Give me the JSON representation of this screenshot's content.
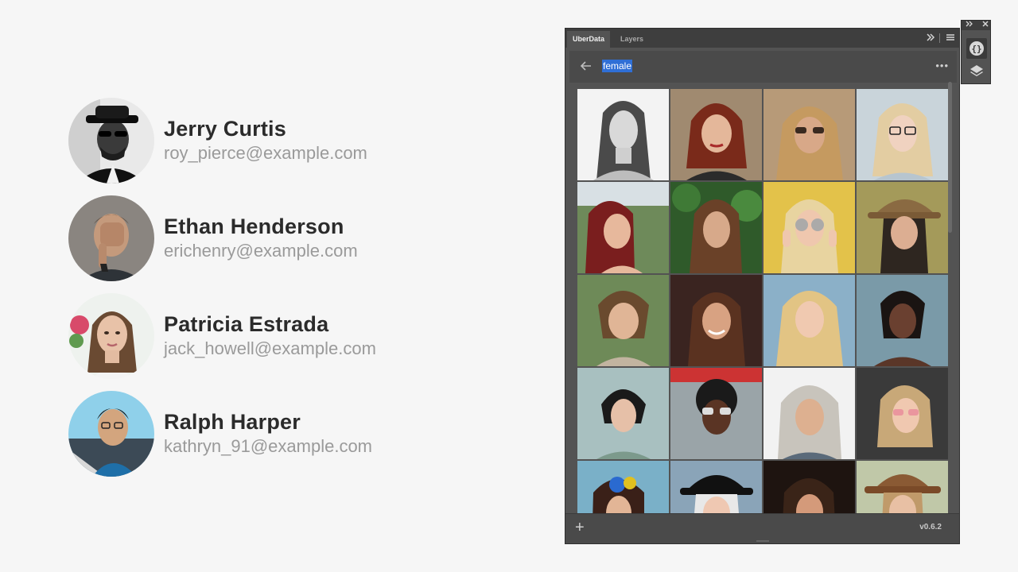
{
  "contacts": [
    {
      "name": "Jerry Curtis",
      "email": "roy_pierce@example.com"
    },
    {
      "name": "Ethan Henderson",
      "email": "erichenry@example.com"
    },
    {
      "name": "Patricia Estrada",
      "email": "jack_howell@example.com"
    },
    {
      "name": "Ralph Harper",
      "email": "kathryn_91@example.com"
    }
  ],
  "panel": {
    "tabs": [
      {
        "label": "UberData"
      },
      {
        "label": "Layers"
      }
    ],
    "search": {
      "value": "female"
    },
    "footer": {
      "add_label": "+",
      "version": "v0.6.2"
    }
  },
  "icons": {
    "back": "arrow-left-icon",
    "more": "more-dots-icon",
    "expand": "double-chevron-right-icon",
    "menu": "hamburger-menu-icon",
    "close": "close-icon",
    "uberdata": "braces-icon",
    "layers": "layers-icon"
  },
  "colors": {
    "panel_bg": "#535353",
    "tabbar_bg": "#3e3e3e",
    "selection": "#2f6fd6",
    "name_text": "#2b2b2b",
    "email_text": "#9a9a9a"
  }
}
